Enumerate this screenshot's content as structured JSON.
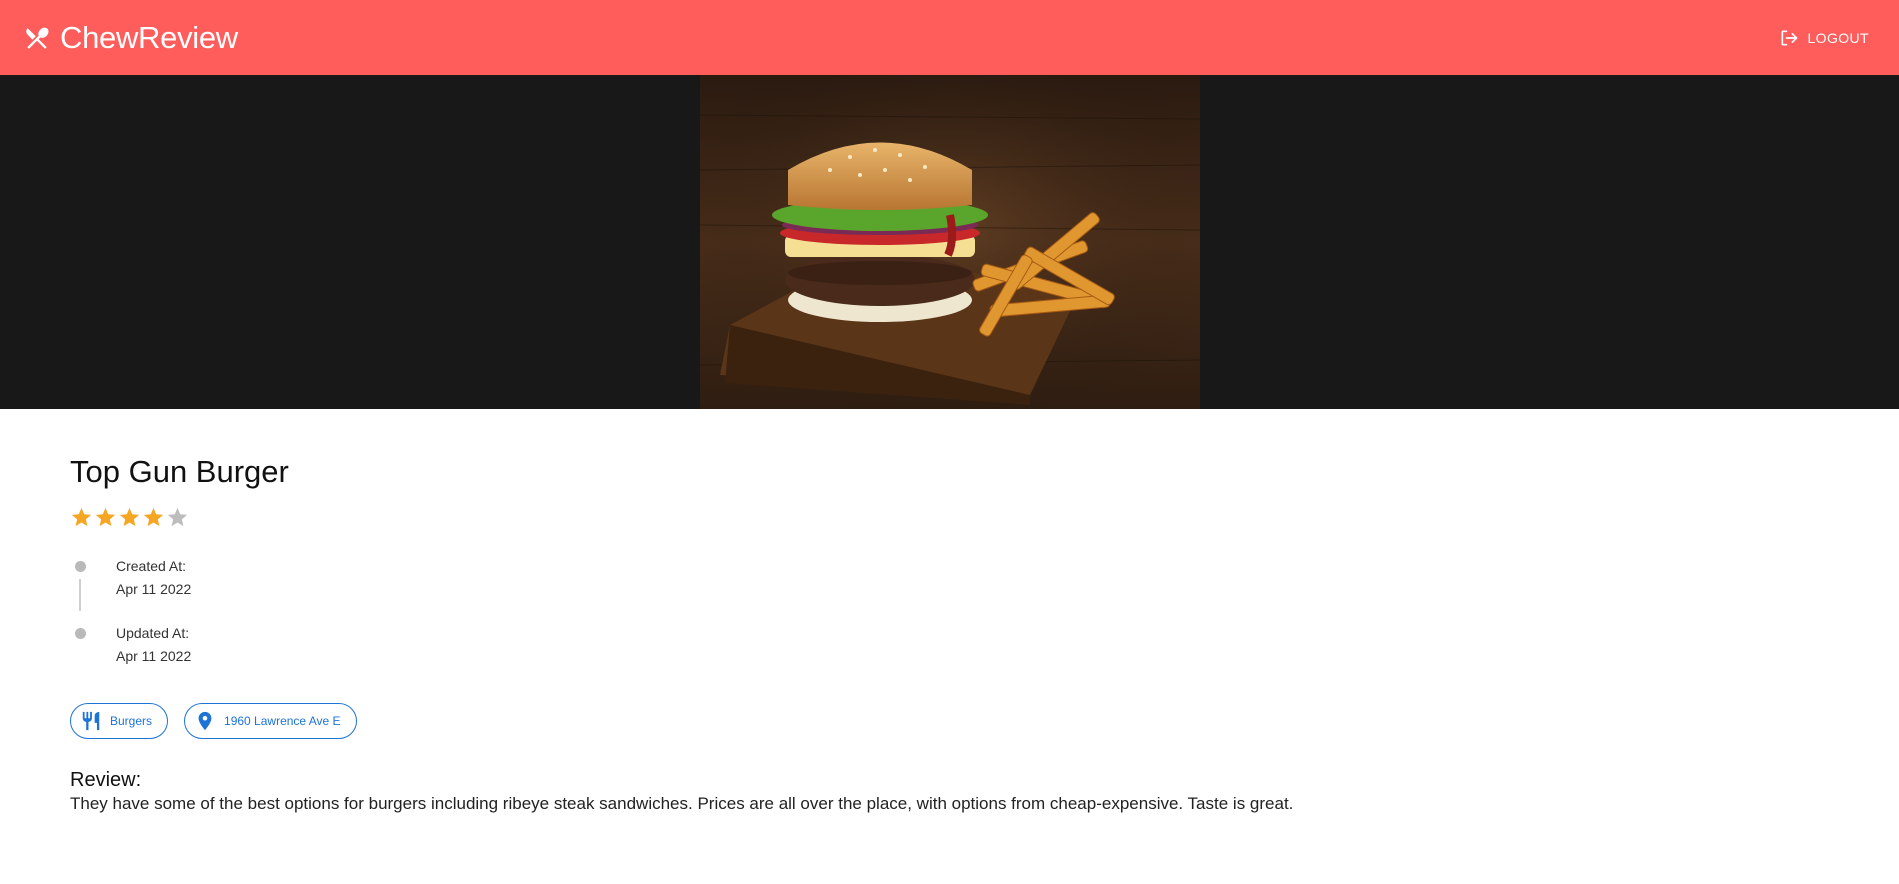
{
  "app": {
    "title": "ChewReview",
    "logo_icon": "fork-spoon-crossed-icon"
  },
  "header": {
    "logout_label": "LOGOUT",
    "logout_icon": "logout-icon"
  },
  "hero": {
    "image_alt": "burger with fries on a wooden board"
  },
  "restaurant": {
    "name": "Top Gun Burger",
    "rating": 4,
    "rating_max": 5
  },
  "timeline": [
    {
      "label": "Created At:",
      "value": "Apr 11 2022"
    },
    {
      "label": "Updated At:",
      "value": "Apr 11 2022"
    }
  ],
  "chips": {
    "category": {
      "label": "Burgers",
      "icon": "restaurant-icon"
    },
    "location": {
      "label": "1960 Lawrence Ave E",
      "icon": "location-pin-icon"
    }
  },
  "review": {
    "title": "Review:",
    "text": "They have some of the best options for burgers including ribeye steak sandwiches. Prices are all over the place, with options from cheap-expensive. Taste is great."
  },
  "colors": {
    "appbar": "#ff5c5c",
    "hero_bg": "#181818",
    "star_filled": "#f5a623",
    "star_empty": "#bdbdbd",
    "chip": "#1e73d6"
  }
}
